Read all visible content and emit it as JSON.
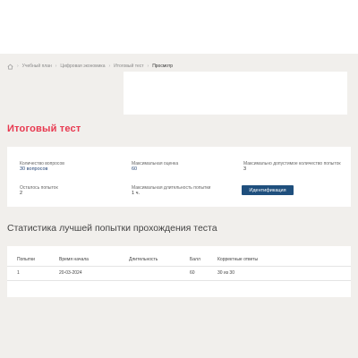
{
  "breadcrumb": {
    "home_icon": "home-icon",
    "items": [
      "Учебный план",
      "Цифровая экономика",
      "Итоговый тест",
      "Просмотр"
    ]
  },
  "page": {
    "title": "Итоговый тест"
  },
  "info": {
    "questions_label": "Количество вопросов",
    "questions_value": "30 вопросов",
    "max_score_label": "Максимальная оценка",
    "max_score_value": "60",
    "max_attempts_label": "Максимально допустимое количество попыток",
    "max_attempts_value": "3",
    "attempts_left_label": "Осталось попыток",
    "attempts_left_value": "2",
    "max_duration_label": "Максимальная длительность попытки",
    "max_duration_value": "1 ч.",
    "identify_button": "Идентификация"
  },
  "stats": {
    "title": "Статистика лучшей попытки прохождения теста",
    "columns": [
      "Попытки",
      "Время начала",
      "Длительность",
      "Балл",
      "Корректные ответы"
    ],
    "rows": [
      [
        "1",
        "20-03-2024",
        "",
        "60",
        "30 из 30"
      ]
    ]
  },
  "colors": {
    "accent": "#e8384f",
    "button": "#1f4f7d",
    "background": "#f1efec"
  }
}
